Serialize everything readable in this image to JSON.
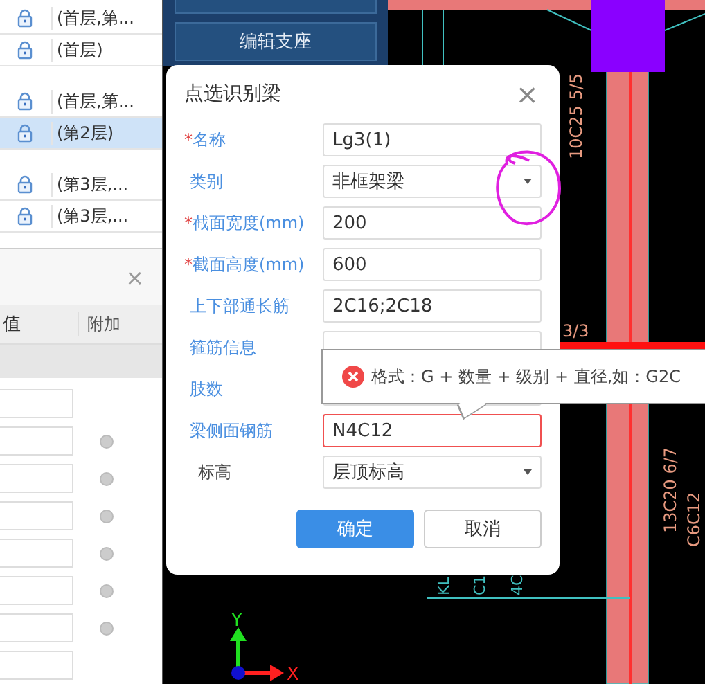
{
  "layer_list": {
    "groups": [
      {
        "rows": [
          {
            "label": "(首层,第...",
            "selected": false
          },
          {
            "label": "(首层)",
            "selected": false
          }
        ]
      },
      {
        "rows": [
          {
            "label": "(首层,第...",
            "selected": false
          },
          {
            "label": "(第2层)",
            "selected": true
          }
        ]
      },
      {
        "rows": [
          {
            "label": "(第3层,...",
            "selected": false
          },
          {
            "label": "(第3层,...",
            "selected": false
          }
        ]
      }
    ]
  },
  "property_panel": {
    "close": "×",
    "columns": [
      {
        "label": "值"
      },
      {
        "label": "附加"
      }
    ],
    "rows": [
      {
        "attached": false
      },
      {
        "attached": true
      },
      {
        "attached": true
      },
      {
        "attached": true
      },
      {
        "attached": true
      },
      {
        "attached": true
      },
      {
        "attached": true
      },
      {
        "attached": false
      }
    ]
  },
  "toolbar": {
    "buttons": [
      {
        "label": "编辑支座"
      }
    ]
  },
  "dialog": {
    "title": "点选识别梁",
    "close": "×",
    "fields": [
      {
        "mark": "*",
        "label": "名称",
        "highlighted": true,
        "kind": "text",
        "value": "Lg3(1)"
      },
      {
        "label": "类别",
        "highlighted": true,
        "kind": "select",
        "value": "非框架梁"
      },
      {
        "mark": "*",
        "label": "截面宽度(mm)",
        "highlighted": true,
        "kind": "text",
        "value": "200"
      },
      {
        "mark": "*",
        "label": "截面高度(mm)",
        "highlighted": true,
        "kind": "text",
        "value": "600"
      },
      {
        "label": "上下部通长筋",
        "highlighted": true,
        "kind": "text",
        "value": "2C16;2C18"
      },
      {
        "label": "箍筋信息",
        "highlighted": true,
        "kind": "text"
      },
      {
        "label": "肢数",
        "highlighted": true,
        "kind": "text"
      },
      {
        "label": "梁侧面钢筋",
        "highlighted": true,
        "kind": "text",
        "value": "N4C12",
        "error": true
      },
      {
        "label": "标高",
        "highlighted": false,
        "kind": "select",
        "value": "层顶标高"
      }
    ],
    "buttons": [
      {
        "label": "确定",
        "primary": true
      },
      {
        "label": "取消",
        "primary": false
      }
    ]
  },
  "tooltip": {
    "text": "格式：G + 数量 + 级别 + 直径,如：G2C"
  },
  "drawing": {
    "texts": [
      "10C25 5/5",
      "3/3",
      "13C20 6/7",
      "C6C12",
      "KL",
      "C1",
      "4C"
    ],
    "axis_labels": [
      "Y",
      "X"
    ]
  }
}
